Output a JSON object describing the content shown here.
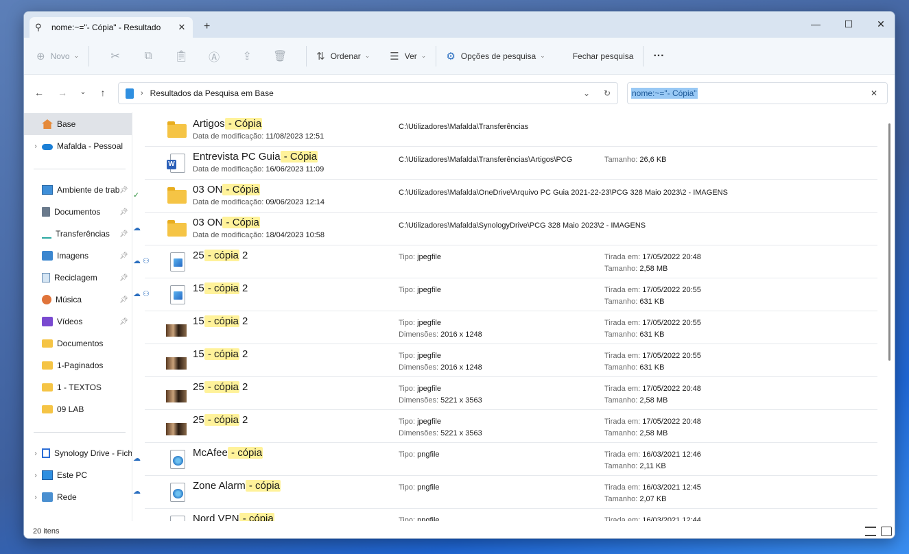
{
  "window": {
    "tab_title": "nome:~=\"- Cópia\" - Resultado",
    "new_tab": "+",
    "controls": {
      "minimize": "—",
      "maximize": "☐",
      "close": "✕"
    }
  },
  "toolbar": {
    "new_label": "Novo",
    "sort_label": "Ordenar",
    "view_label": "Ver",
    "search_options_label": "Opções de pesquisa",
    "close_search_label": "Fechar pesquisa",
    "more_label": "···"
  },
  "address": {
    "path": "Resultados da Pesquisa em Base",
    "search_query": "nome:~=\"- Cópia\""
  },
  "sidebar": {
    "items": [
      {
        "label": "Base",
        "icon": "home-icon",
        "active": true
      },
      {
        "label": "Mafalda - Pessoal",
        "icon": "onedrive-icon"
      },
      {
        "label": "Ambiente de trabalho",
        "icon": "desktop-icon",
        "pinned": true
      },
      {
        "label": "Documentos",
        "icon": "documents-icon",
        "pinned": true
      },
      {
        "label": "Transferências",
        "icon": "download-icon",
        "pinned": true
      },
      {
        "label": "Imagens",
        "icon": "pictures-icon",
        "pinned": true
      },
      {
        "label": "Reciclagem",
        "icon": "recycle-bin-icon",
        "pinned": true
      },
      {
        "label": "Música",
        "icon": "music-icon",
        "pinned": true
      },
      {
        "label": "Vídeos",
        "icon": "videos-icon",
        "pinned": true
      },
      {
        "label": "Documentos",
        "icon": "folder-icon"
      },
      {
        "label": "1-Paginados",
        "icon": "folder-icon"
      },
      {
        "label": "1 - TEXTOS",
        "icon": "folder-icon"
      },
      {
        "label": "09 LAB",
        "icon": "folder-icon"
      },
      {
        "label": "Synology Drive - Ficheiros",
        "icon": "synology-icon"
      },
      {
        "label": "Este PC",
        "icon": "pc-icon"
      },
      {
        "label": "Rede",
        "icon": "network-icon"
      }
    ]
  },
  "labels": {
    "modified": "Data de modificação:",
    "type": "Tipo:",
    "dimensions": "Dimensões:",
    "taken": "Tirada em:",
    "size": "Tamanho:"
  },
  "files": [
    {
      "name": "Artigos",
      "match": " - Cópia",
      "modified": "11/08/2023 12:51",
      "path": "C:\\Utilizadores\\Mafalda\\Transferências",
      "icon": "folder-icon"
    },
    {
      "name": "Entrevista PC Guia",
      "match": " - Cópia",
      "modified": "16/06/2023 11:09",
      "path": "C:\\Utilizadores\\Mafalda\\Transferências\\Artigos\\PCG",
      "size": "26,6 KB",
      "icon": "word-doc-icon"
    },
    {
      "name": "03 ON",
      "match": " - Cópia",
      "modified": "09/06/2023 12:14",
      "path": "C:\\Utilizadores\\Mafalda\\OneDrive\\Arquivo PC Guia 2021-22-23\\PCG 328 Maio 2023\\2 - IMAGENS",
      "icon": "folder-icon",
      "status": "✓"
    },
    {
      "name": "03 ON",
      "match": " - Cópia",
      "modified": "18/04/2023 10:58",
      "path": "C:\\Utilizadores\\Mafalda\\SynologyDrive\\PCG 328 Maio 2023\\2 - IMAGENS",
      "icon": "folder-icon",
      "status": "☁"
    },
    {
      "name": "25",
      "match": " - cópia",
      "suffix": " 2",
      "type": "jpegfile",
      "taken": "17/05/2022 20:48",
      "size": "2,58 MB",
      "icon": "image-file-icon",
      "status": "☁ ⚇"
    },
    {
      "name": "15",
      "match": " - cópia",
      "suffix": " 2",
      "type": "jpegfile",
      "taken": "17/05/2022 20:55",
      "size": "631 KB",
      "icon": "image-file-icon",
      "status": "☁ ⚇"
    },
    {
      "name": "15",
      "match": " - cópia",
      "suffix": " 2",
      "type": "jpegfile",
      "dimensions": "2016 x 1248",
      "taken": "17/05/2022 20:55",
      "size": "631 KB",
      "icon": "photo-thumbnail-icon"
    },
    {
      "name": "15",
      "match": " - cópia",
      "suffix": " 2",
      "type": "jpegfile",
      "dimensions": "2016 x 1248",
      "taken": "17/05/2022 20:55",
      "size": "631 KB",
      "icon": "photo-thumbnail-icon"
    },
    {
      "name": "25",
      "match": " - cópia",
      "suffix": " 2",
      "type": "jpegfile",
      "dimensions": "5221 x 3563",
      "taken": "17/05/2022 20:48",
      "size": "2,58 MB",
      "icon": "photo-thumbnail-icon"
    },
    {
      "name": "25",
      "match": " - cópia",
      "suffix": " 2",
      "type": "jpegfile",
      "dimensions": "5221 x 3563",
      "taken": "17/05/2022 20:48",
      "size": "2,58 MB",
      "icon": "photo-thumbnail-icon"
    },
    {
      "name": "McAfee",
      "match": " - cópia",
      "type": "pngfile",
      "taken": "16/03/2021 12:46",
      "size": "2,11 KB",
      "icon": "png-file-icon",
      "status": "☁"
    },
    {
      "name": "Zone Alarm",
      "match": " - cópia",
      "type": "pngfile",
      "taken": "16/03/2021 12:45",
      "size": "2,07 KB",
      "icon": "png-file-icon",
      "status": "☁"
    },
    {
      "name": "Nord VPN",
      "match": " - cópia",
      "type": "pngfile",
      "taken": "16/03/2021 12:44",
      "icon": "png-file-icon"
    }
  ],
  "status": {
    "count": "20 itens"
  },
  "colors": {
    "accent": "#2f8fe0",
    "highlight": "#fff29a",
    "folder": "#f5c445"
  }
}
